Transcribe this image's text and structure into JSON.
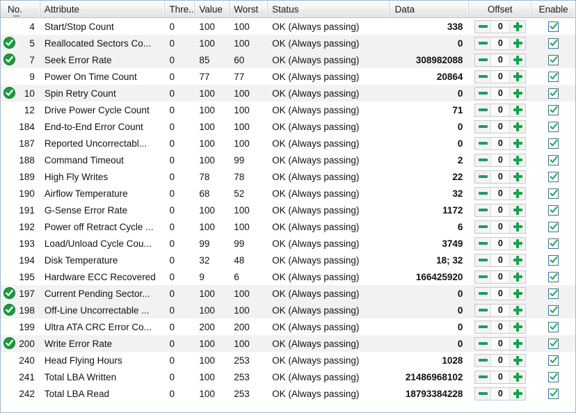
{
  "table": {
    "columns": [
      {
        "key": "no",
        "label": "No."
      },
      {
        "key": "attr",
        "label": "Attribute"
      },
      {
        "key": "thresh",
        "label": "Thre..."
      },
      {
        "key": "value",
        "label": "Value"
      },
      {
        "key": "worst",
        "label": "Worst"
      },
      {
        "key": "status",
        "label": "Status"
      },
      {
        "key": "data",
        "label": "Data"
      },
      {
        "key": "offset",
        "label": "Offset"
      },
      {
        "key": "enable",
        "label": "Enable"
      }
    ],
    "sort_column": "No.",
    "offset_default": "0",
    "rows": [
      {
        "badge": false,
        "no": "4",
        "attr": "Start/Stop Count",
        "thresh": "0",
        "value": "100",
        "worst": "100",
        "status": "OK (Always passing)",
        "data": "338",
        "offset": "0",
        "enabled": true,
        "shaded": false
      },
      {
        "badge": true,
        "no": "5",
        "attr": "Reallocated Sectors Co...",
        "thresh": "0",
        "value": "100",
        "worst": "100",
        "status": "OK (Always passing)",
        "data": "0",
        "offset": "0",
        "enabled": true,
        "shaded": true
      },
      {
        "badge": true,
        "no": "7",
        "attr": "Seek Error Rate",
        "thresh": "0",
        "value": "85",
        "worst": "60",
        "status": "OK (Always passing)",
        "data": "308982088",
        "offset": "0",
        "enabled": true,
        "shaded": true
      },
      {
        "badge": false,
        "no": "9",
        "attr": "Power On Time Count",
        "thresh": "0",
        "value": "77",
        "worst": "77",
        "status": "OK (Always passing)",
        "data": "20864",
        "offset": "0",
        "enabled": true,
        "shaded": false
      },
      {
        "badge": true,
        "no": "10",
        "attr": "Spin Retry Count",
        "thresh": "0",
        "value": "100",
        "worst": "100",
        "status": "OK (Always passing)",
        "data": "0",
        "offset": "0",
        "enabled": true,
        "shaded": true
      },
      {
        "badge": false,
        "no": "12",
        "attr": "Drive Power Cycle Count",
        "thresh": "0",
        "value": "100",
        "worst": "100",
        "status": "OK (Always passing)",
        "data": "71",
        "offset": "0",
        "enabled": true,
        "shaded": false
      },
      {
        "badge": false,
        "no": "184",
        "attr": "End-to-End Error Count",
        "thresh": "0",
        "value": "100",
        "worst": "100",
        "status": "OK (Always passing)",
        "data": "0",
        "offset": "0",
        "enabled": true,
        "shaded": false
      },
      {
        "badge": false,
        "no": "187",
        "attr": "Reported Uncorrectabl...",
        "thresh": "0",
        "value": "100",
        "worst": "100",
        "status": "OK (Always passing)",
        "data": "0",
        "offset": "0",
        "enabled": true,
        "shaded": false
      },
      {
        "badge": false,
        "no": "188",
        "attr": "Command Timeout",
        "thresh": "0",
        "value": "100",
        "worst": "99",
        "status": "OK (Always passing)",
        "data": "2",
        "offset": "0",
        "enabled": true,
        "shaded": false
      },
      {
        "badge": false,
        "no": "189",
        "attr": "High Fly Writes",
        "thresh": "0",
        "value": "78",
        "worst": "78",
        "status": "OK (Always passing)",
        "data": "22",
        "offset": "0",
        "enabled": true,
        "shaded": false
      },
      {
        "badge": false,
        "no": "190",
        "attr": "Airflow Temperature",
        "thresh": "0",
        "value": "68",
        "worst": "52",
        "status": "OK (Always passing)",
        "data": "32",
        "offset": "0",
        "enabled": true,
        "shaded": false
      },
      {
        "badge": false,
        "no": "191",
        "attr": "G-Sense Error Rate",
        "thresh": "0",
        "value": "100",
        "worst": "100",
        "status": "OK (Always passing)",
        "data": "1172",
        "offset": "0",
        "enabled": true,
        "shaded": false
      },
      {
        "badge": false,
        "no": "192",
        "attr": "Power off Retract Cycle ...",
        "thresh": "0",
        "value": "100",
        "worst": "100",
        "status": "OK (Always passing)",
        "data": "6",
        "offset": "0",
        "enabled": true,
        "shaded": false
      },
      {
        "badge": false,
        "no": "193",
        "attr": "Load/Unload Cycle Cou...",
        "thresh": "0",
        "value": "99",
        "worst": "99",
        "status": "OK (Always passing)",
        "data": "3749",
        "offset": "0",
        "enabled": true,
        "shaded": false
      },
      {
        "badge": false,
        "no": "194",
        "attr": "Disk Temperature",
        "thresh": "0",
        "value": "32",
        "worst": "48",
        "status": "OK (Always passing)",
        "data": "18; 32",
        "offset": "0",
        "enabled": true,
        "shaded": false
      },
      {
        "badge": false,
        "no": "195",
        "attr": "Hardware ECC Recovered",
        "thresh": "0",
        "value": "9",
        "worst": "6",
        "status": "OK (Always passing)",
        "data": "166425920",
        "offset": "0",
        "enabled": true,
        "shaded": false
      },
      {
        "badge": true,
        "no": "197",
        "attr": "Current Pending Sector...",
        "thresh": "0",
        "value": "100",
        "worst": "100",
        "status": "OK (Always passing)",
        "data": "0",
        "offset": "0",
        "enabled": true,
        "shaded": true
      },
      {
        "badge": true,
        "no": "198",
        "attr": "Off-Line Uncorrectable ...",
        "thresh": "0",
        "value": "100",
        "worst": "100",
        "status": "OK (Always passing)",
        "data": "0",
        "offset": "0",
        "enabled": true,
        "shaded": true
      },
      {
        "badge": false,
        "no": "199",
        "attr": "Ultra ATA CRC Error Co...",
        "thresh": "0",
        "value": "200",
        "worst": "200",
        "status": "OK (Always passing)",
        "data": "0",
        "offset": "0",
        "enabled": true,
        "shaded": false
      },
      {
        "badge": true,
        "no": "200",
        "attr": "Write Error Rate",
        "thresh": "0",
        "value": "100",
        "worst": "100",
        "status": "OK (Always passing)",
        "data": "0",
        "offset": "0",
        "enabled": true,
        "shaded": true
      },
      {
        "badge": false,
        "no": "240",
        "attr": "Head Flying Hours",
        "thresh": "0",
        "value": "100",
        "worst": "253",
        "status": "OK (Always passing)",
        "data": "1028",
        "offset": "0",
        "enabled": true,
        "shaded": false
      },
      {
        "badge": false,
        "no": "241",
        "attr": "Total LBA Written",
        "thresh": "0",
        "value": "100",
        "worst": "253",
        "status": "OK (Always passing)",
        "data": "21486968102",
        "offset": "0",
        "enabled": true,
        "shaded": false
      },
      {
        "badge": false,
        "no": "242",
        "attr": "Total LBA Read",
        "thresh": "0",
        "value": "100",
        "worst": "253",
        "status": "OK (Always passing)",
        "data": "18793384228",
        "offset": "0",
        "enabled": true,
        "shaded": false
      }
    ]
  },
  "colors": {
    "badge_green": "#1a9c3c",
    "plus_green": "#16a34a",
    "minus_green": "#1f9a63",
    "check_green": "#1faa4e",
    "checkbox_border": "#3f6f94",
    "row_alt": "#f2f2f2",
    "panel_border": "#9fb6c9"
  },
  "icons": {
    "ok_badge": "check-circle-icon",
    "minus": "minus-icon",
    "plus": "plus-icon",
    "checkbox_check": "checkmark-icon",
    "sort": "sort-ascending-icon"
  }
}
